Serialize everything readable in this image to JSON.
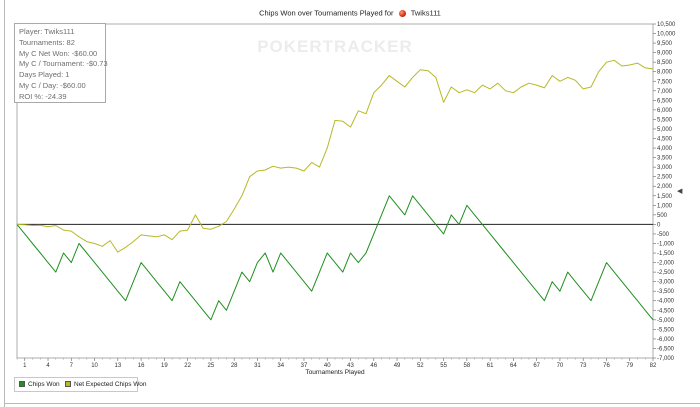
{
  "title": "Chips Won over Tournaments Played for",
  "player_name": "Twiks111",
  "watermark": "POKERTRACKER",
  "stats": [
    "Player: Twiks111",
    "Tournaments: 82",
    "My C Net Won: -$60.00",
    "My C / Tournament: -$0.73",
    "Days Played: 1",
    "My C / Day: -$60.00",
    "ROI %: -24.39"
  ],
  "legend": {
    "items": [
      {
        "label": "Chips Won",
        "color": "#1f8f1f"
      },
      {
        "label": "Net Expected Chips Won",
        "color": "#b8b828"
      }
    ]
  },
  "chart_data": {
    "type": "line",
    "title": "Chips Won over Tournaments Played for Twiks111",
    "xlabel": "Tournaments Played",
    "ylabel": "",
    "xlim": [
      0,
      82
    ],
    "ylim": [
      -7000,
      10500
    ],
    "x_ticks": [
      1,
      4,
      7,
      10,
      13,
      16,
      19,
      22,
      25,
      28,
      31,
      34,
      37,
      40,
      43,
      46,
      49,
      52,
      55,
      58,
      61,
      64,
      67,
      70,
      73,
      76,
      79,
      82
    ],
    "y_ticks": [
      -7000,
      -6500,
      -6000,
      -5500,
      -5000,
      -4500,
      -4000,
      -3500,
      -3000,
      -2500,
      -2000,
      -1500,
      -1000,
      -500,
      0,
      500,
      1000,
      1500,
      2000,
      2500,
      3000,
      3500,
      4000,
      4500,
      5000,
      5500,
      6000,
      6500,
      7000,
      7500,
      8000,
      8500,
      9000,
      9500,
      10000,
      10500
    ],
    "y_tick_labels": [
      "-7,000",
      "-6,500",
      "-6,000",
      "-5,500",
      "-5,000",
      "-4,500",
      "-4,000",
      "-3,500",
      "-3,000",
      "-2,500",
      "-2,000",
      "-1,500",
      "-1,000",
      "-500",
      "0",
      "500",
      "1,000",
      "1,500",
      "2,000",
      "2,500",
      "3,000",
      "3,500",
      "4,000",
      "4,500",
      "5,000",
      "5,500",
      "6,000",
      "6,500",
      "7,000",
      "7,500",
      "8,000",
      "8,500",
      "9,000",
      "9,500",
      "10,000",
      "10,500"
    ],
    "grid": false,
    "legend_position": "bottom-left",
    "x": [
      0,
      1,
      2,
      3,
      4,
      5,
      6,
      7,
      8,
      9,
      10,
      11,
      12,
      13,
      14,
      15,
      16,
      17,
      18,
      19,
      20,
      21,
      22,
      23,
      24,
      25,
      26,
      27,
      28,
      29,
      30,
      31,
      32,
      33,
      34,
      35,
      36,
      37,
      38,
      39,
      40,
      41,
      42,
      43,
      44,
      45,
      46,
      47,
      48,
      49,
      50,
      51,
      52,
      53,
      54,
      55,
      56,
      57,
      58,
      59,
      60,
      61,
      62,
      63,
      64,
      65,
      66,
      67,
      68,
      69,
      70,
      71,
      72,
      73,
      74,
      75,
      76,
      77,
      78,
      79,
      80,
      81,
      82
    ],
    "series": [
      {
        "name": "Chips Won",
        "color": "#1f8f1f",
        "values": [
          0,
          -500,
          -1000,
          -1500,
          -2000,
          -2500,
          -1500,
          -2000,
          -1000,
          -1500,
          -2000,
          -2500,
          -3000,
          -3500,
          -4000,
          -3000,
          -2000,
          -2500,
          -3000,
          -3500,
          -4000,
          -3000,
          -3500,
          -4000,
          -4500,
          -5000,
          -4000,
          -4500,
          -3500,
          -2500,
          -3000,
          -2000,
          -1500,
          -2500,
          -1500,
          -2000,
          -2500,
          -3000,
          -3500,
          -2500,
          -1500,
          -2000,
          -2500,
          -1500,
          -2000,
          -1500,
          -500,
          500,
          1500,
          1000,
          500,
          1500,
          1000,
          500,
          0,
          -500,
          500,
          0,
          1000,
          500,
          0,
          -500,
          -1000,
          -1500,
          -2000,
          -2500,
          -3000,
          -3500,
          -4000,
          -3000,
          -3500,
          -2500,
          -3000,
          -3500,
          -4000,
          -3000,
          -2000,
          -2500,
          -3000,
          -3500,
          -4000,
          -4500,
          -5000
        ]
      },
      {
        "name": "Net Expected Chips Won",
        "color": "#b8b828",
        "values": [
          0,
          -20,
          -60,
          -40,
          -120,
          -60,
          -300,
          -350,
          -650,
          -900,
          -1000,
          -1150,
          -850,
          -1450,
          -1200,
          -900,
          -550,
          -600,
          -650,
          -550,
          -800,
          -350,
          -300,
          500,
          -200,
          -250,
          -100,
          150,
          800,
          1500,
          2500,
          2800,
          2850,
          3050,
          2950,
          3000,
          2950,
          2800,
          3250,
          3000,
          4000,
          5450,
          5400,
          5100,
          5950,
          5800,
          6900,
          7300,
          7800,
          7500,
          7200,
          7700,
          8100,
          8050,
          7700,
          6400,
          7200,
          6900,
          7050,
          6900,
          7300,
          7100,
          7400,
          7000,
          6900,
          7200,
          7400,
          7300,
          7150,
          7800,
          7500,
          7700,
          7550,
          7100,
          7200,
          8000,
          8500,
          8600,
          8300,
          8350,
          8450,
          8200,
          8150
        ]
      }
    ]
  }
}
